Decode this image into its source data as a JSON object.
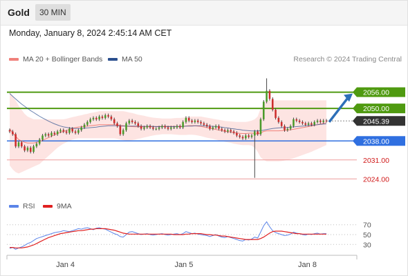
{
  "header": {
    "symbol": "Gold",
    "timeframe": "30 MIN",
    "datetime": "Monday, January 8, 2024 2:45:14 AM CET",
    "copyright": "Research © 2024 Trading Central"
  },
  "legend": {
    "bollinger": {
      "label": "MA 20 + Bollinger Bands",
      "color": "#f0807a"
    },
    "ma50": {
      "label": "MA 50",
      "color": "#2b4f8e"
    }
  },
  "rsi_legend": {
    "rsi": {
      "label": "RSI",
      "color": "#5b84e8"
    },
    "ma9": {
      "label": "9MA",
      "color": "#e02020"
    }
  },
  "colors": {
    "up": "#4a9a2a",
    "down": "#cc2d2d",
    "resistance": "#4f9a10",
    "support_blue": "#2f6fe0",
    "support_red": "#ee9a9a",
    "band_fill": "#fde4e2",
    "current_label_bg": "#333333",
    "arrow": "#2d6fb8"
  },
  "chart_data": [
    {
      "type": "line",
      "title": "",
      "description_role": "price",
      "x_ticks": [
        "Jan 4",
        "Jan 5",
        "Jan 8"
      ],
      "price_ylim": [
        2020.0,
        2062.0
      ],
      "levels": [
        {
          "label": "2056.00",
          "value": 2056.0,
          "kind": "resistance"
        },
        {
          "label": "2050.00",
          "value": 2050.0,
          "kind": "resistance"
        },
        {
          "label": "2045.39",
          "value": 2045.39,
          "kind": "current"
        },
        {
          "label": "2038.00",
          "value": 2038.0,
          "kind": "pivot"
        },
        {
          "label": "2031.00",
          "value": 2031.0,
          "kind": "support"
        },
        {
          "label": "2024.00",
          "value": 2024.0,
          "kind": "support"
        }
      ],
      "close": [
        2041.5,
        2040.5,
        2036.0,
        2037.5,
        2036.0,
        2034.5,
        2035.5,
        2034.0,
        2036.0,
        2037.0,
        2038.5,
        2040.0,
        2040.5,
        2040.0,
        2041.0,
        2040.5,
        2041.5,
        2042.0,
        2041.5,
        2041.0,
        2042.5,
        2041.5,
        2041.0,
        2042.0,
        2043.0,
        2044.0,
        2045.0,
        2046.0,
        2046.5,
        2046.0,
        2047.0,
        2046.5,
        2047.5,
        2047.0,
        2046.0,
        2044.5,
        2043.5,
        2040.5,
        2042.0,
        2044.5,
        2045.5,
        2045.0,
        2044.5,
        2043.5,
        2042.5,
        2043.0,
        2043.5,
        2043.0,
        2042.5,
        2042.5,
        2043.0,
        2043.5,
        2043.0,
        2042.5,
        2043.0,
        2043.0,
        2043.5,
        2043.0,
        2045.0,
        2046.5,
        2045.5,
        2045.0,
        2045.5,
        2045.0,
        2044.5,
        2044.0,
        2043.5,
        2042.5,
        2043.0,
        2043.5,
        2042.5,
        2042.0,
        2041.5,
        2042.0,
        2041.5,
        2041.0,
        2040.0,
        2039.5,
        2039.0,
        2040.0,
        2039.5,
        2040.0,
        2041.5,
        2040.5,
        2046.0,
        2052.5,
        2056.5,
        2053.5,
        2049.5,
        2046.5,
        2045.0,
        2043.5,
        2042.0,
        2042.5,
        2043.5,
        2046.0,
        2045.5,
        2045.0,
        2044.5,
        2044.0,
        2044.5,
        2044.0,
        2045.0,
        2045.5,
        2045.0,
        2045.5,
        2045.39
      ],
      "ma50": [
        2055.5,
        2054.5,
        2053.5,
        2052.5,
        2051.6,
        2050.8,
        2050.0,
        2049.2,
        2048.5,
        2047.8,
        2047.1,
        2046.5,
        2045.9,
        2045.3,
        2044.8,
        2044.3,
        2043.9,
        2043.5,
        2043.2,
        2043.0,
        2042.8,
        2042.7,
        2042.6,
        2042.6,
        2042.6,
        2042.7,
        2042.8,
        2042.9,
        2043.0,
        2043.1,
        2043.3,
        2043.4,
        2043.5,
        2043.6,
        2043.6,
        2043.6,
        2043.6,
        2043.5,
        2043.5,
        2043.5,
        2043.5,
        2043.5,
        2043.5,
        2043.5,
        2043.4,
        2043.4,
        2043.4,
        2043.4,
        2043.4,
        2043.3,
        2043.3,
        2043.3,
        2043.3,
        2043.3,
        2043.3,
        2043.3,
        2043.3,
        2043.3,
        2043.4,
        2043.5,
        2043.5,
        2043.5,
        2043.6,
        2043.6,
        2043.6,
        2043.6,
        2043.5,
        2043.5,
        2043.4,
        2043.3,
        2043.2,
        2043.1,
        2042.9,
        2042.8,
        2042.6,
        2042.5,
        2042.3,
        2042.2,
        2042.0,
        2041.9,
        2041.8,
        2041.7,
        2041.7,
        2041.7,
        2041.8,
        2042.0,
        2042.2,
        2042.4,
        2042.6,
        2042.7,
        2042.8,
        2042.9,
        2042.9,
        2043.0,
        2043.1,
        2043.2,
        2043.3,
        2043.4,
        2043.5,
        2043.6,
        2043.7,
        2043.8,
        2043.9,
        2044.0,
        2044.1,
        2044.2,
        2044.3
      ],
      "bb_upper": [
        2056.0,
        2054.5,
        2053.0,
        2051.0,
        2049.5,
        2048.0,
        2047.0,
        2046.5,
        2046.0,
        2046.0,
        2046.0,
        2046.0,
        2046.0,
        2046.0,
        2046.0,
        2046.0,
        2046.0,
        2046.0,
        2046.0,
        2046.2,
        2046.5,
        2046.8,
        2047.0,
        2047.3,
        2047.5,
        2047.8,
        2048.0,
        2048.3,
        2048.5,
        2048.7,
        2049.0,
        2049.0,
        2049.0,
        2049.0,
        2049.0,
        2049.0,
        2049.0,
        2049.0,
        2049.0,
        2048.8,
        2048.5,
        2048.3,
        2048.0,
        2047.7,
        2047.5,
        2047.3,
        2047.0,
        2046.8,
        2046.6,
        2046.5,
        2046.4,
        2046.3,
        2046.3,
        2046.3,
        2046.3,
        2046.4,
        2046.5,
        2046.5,
        2046.6,
        2046.8,
        2047.0,
        2047.0,
        2047.0,
        2047.0,
        2047.0,
        2046.8,
        2046.6,
        2046.4,
        2046.2,
        2046.0,
        2045.8,
        2045.6,
        2045.4,
        2045.3,
        2045.2,
        2045.1,
        2045.0,
        2045.0,
        2045.0,
        2045.0,
        2045.2,
        2045.5,
        2046.0,
        2047.0,
        2050.0,
        2052.0,
        2053.0,
        2053.0,
        2053.0,
        2053.0,
        2053.0,
        2053.0,
        2053.0,
        2053.0,
        2053.0,
        2053.0,
        2053.0,
        2053.0,
        2053.0,
        2053.0,
        2053.0,
        2053.0,
        2053.0,
        2053.0,
        2053.0,
        2053.0,
        2053.0
      ],
      "bb_lower": [
        2029.0,
        2027.5,
        2026.5,
        2026.0,
        2026.5,
        2027.0,
        2027.5,
        2028.0,
        2028.5,
        2029.0,
        2029.5,
        2030.5,
        2031.5,
        2032.5,
        2033.5,
        2034.5,
        2035.5,
        2036.3,
        2037.0,
        2037.5,
        2038.0,
        2038.5,
        2038.8,
        2039.0,
        2039.0,
        2039.0,
        2039.0,
        2039.0,
        2039.0,
        2039.0,
        2039.0,
        2039.0,
        2039.0,
        2039.0,
        2039.0,
        2039.0,
        2038.8,
        2038.5,
        2038.3,
        2038.2,
        2038.2,
        2038.3,
        2038.5,
        2038.8,
        2039.0,
        2039.3,
        2039.5,
        2039.8,
        2040.0,
        2040.2,
        2040.3,
        2040.5,
        2040.5,
        2040.5,
        2040.5,
        2040.4,
        2040.3,
        2040.2,
        2040.2,
        2040.2,
        2040.3,
        2040.3,
        2040.2,
        2040.0,
        2039.8,
        2039.5,
        2039.2,
        2039.0,
        2038.8,
        2038.5,
        2038.2,
        2038.0,
        2037.7,
        2037.5,
        2037.3,
        2037.0,
        2036.8,
        2036.6,
        2036.5,
        2036.5,
        2036.5,
        2036.3,
        2035.5,
        2034.0,
        2032.0,
        2031.0,
        2030.5,
        2030.5,
        2030.5,
        2030.5,
        2030.5,
        2030.6,
        2030.8,
        2031.0,
        2031.3,
        2031.6,
        2032.0,
        2032.4,
        2032.8,
        2033.2,
        2033.6,
        2034.0,
        2034.5,
        2035.0,
        2035.5,
        2036.0,
        2036.5
      ]
    },
    {
      "type": "line",
      "title": "",
      "description_role": "rsi",
      "y_ticks": [
        70,
        50,
        30
      ],
      "ylim": [
        15,
        85
      ],
      "series": [
        {
          "name": "RSI",
          "values": [
            22,
            24,
            20,
            23,
            25,
            28,
            32,
            34,
            38,
            42,
            44,
            46,
            48,
            50,
            52,
            54,
            55,
            56,
            58,
            57,
            56,
            58,
            60,
            62,
            61,
            63,
            64,
            62,
            60,
            63,
            64,
            62,
            61,
            58,
            55,
            52,
            50,
            46,
            45,
            50,
            55,
            56,
            54,
            52,
            50,
            51,
            52,
            50,
            49,
            50,
            51,
            52,
            50,
            49,
            50,
            51,
            52,
            50,
            52,
            56,
            54,
            52,
            53,
            51,
            50,
            49,
            48,
            46,
            48,
            50,
            47,
            45,
            44,
            46,
            44,
            42,
            40,
            38,
            37,
            40,
            39,
            41,
            45,
            43,
            55,
            68,
            76,
            66,
            58,
            54,
            52,
            50,
            48,
            49,
            51,
            55,
            53,
            52,
            50,
            49,
            51,
            50,
            52,
            53,
            51,
            52,
            52
          ]
        },
        {
          "name": "9MA",
          "values": [
            24,
            24,
            23,
            23,
            23,
            24,
            25,
            27,
            29,
            32,
            35,
            38,
            41,
            44,
            46,
            48,
            50,
            52,
            53,
            54,
            55,
            56,
            57,
            58,
            58,
            59,
            60,
            61,
            61,
            62,
            62,
            62,
            62,
            61,
            60,
            59,
            57,
            55,
            53,
            52,
            51,
            51,
            51,
            51,
            51,
            51,
            51,
            51,
            51,
            51,
            51,
            51,
            51,
            51,
            51,
            50,
            50,
            50,
            50,
            51,
            51,
            52,
            52,
            52,
            52,
            51,
            50,
            50,
            49,
            49,
            48,
            47,
            47,
            46,
            45,
            44,
            43,
            42,
            41,
            40,
            40,
            40,
            40,
            40,
            42,
            45,
            49,
            53,
            56,
            57,
            57,
            57,
            56,
            55,
            54,
            53,
            52,
            52,
            51,
            51,
            51,
            51,
            51,
            51,
            51,
            51,
            51
          ]
        }
      ]
    }
  ]
}
